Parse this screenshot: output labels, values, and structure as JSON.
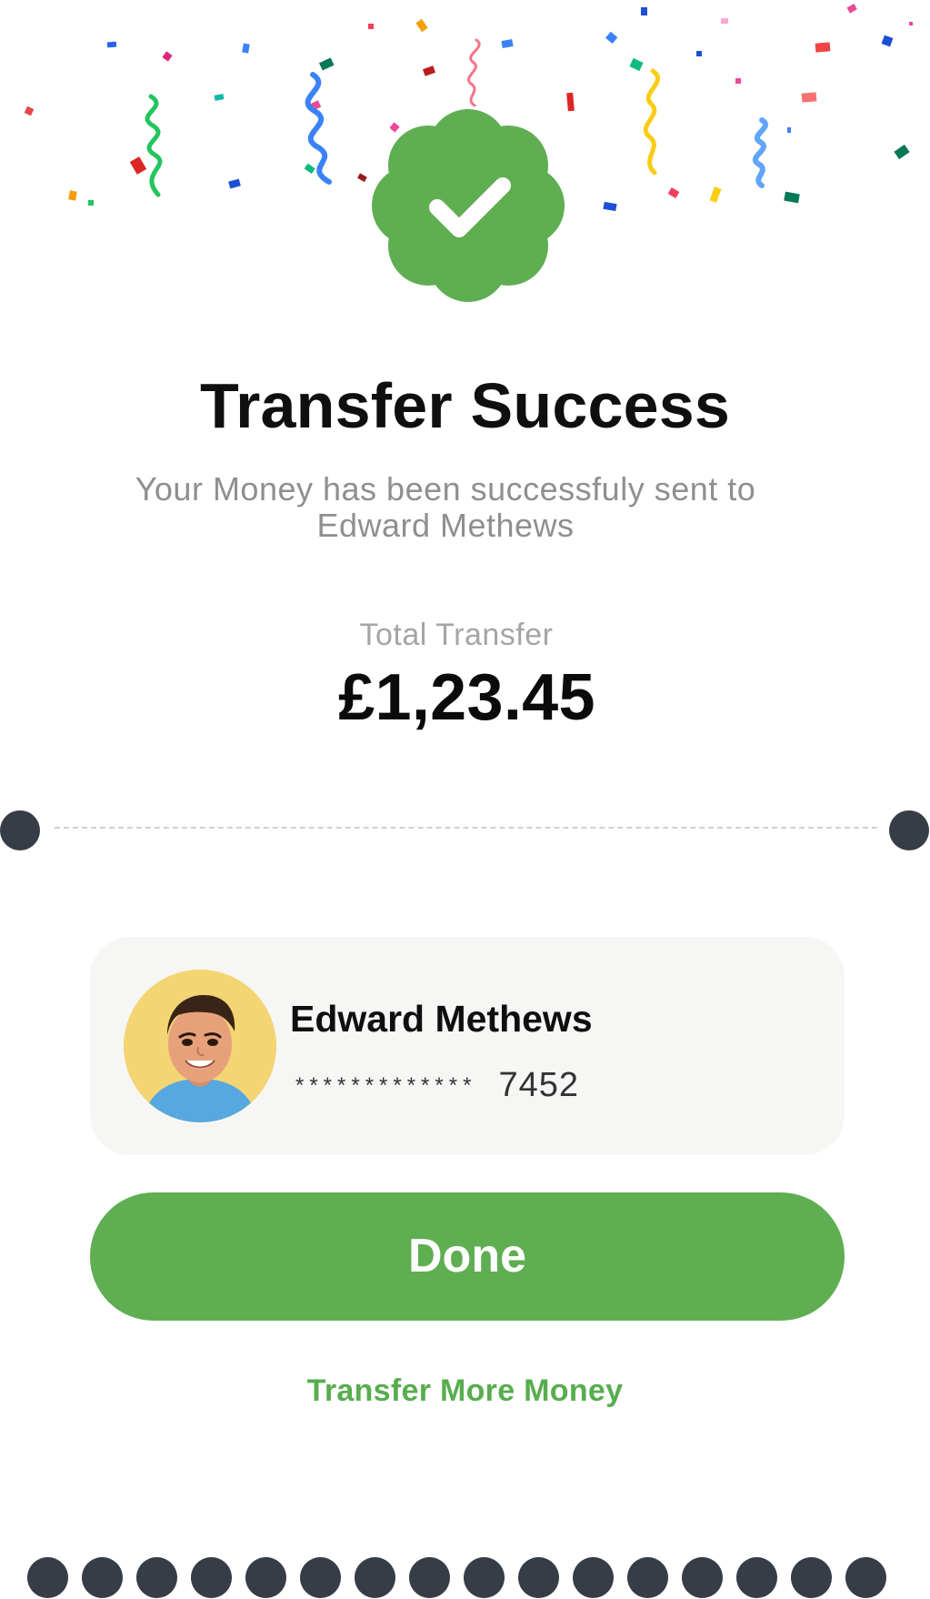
{
  "header": {
    "title": "Transfer Success",
    "subtitle": "Your Money has been successfuly sent to Edward Methews"
  },
  "summary": {
    "total_label": "Total Transfer",
    "amount": "£1,23.45"
  },
  "recipient": {
    "name": "Edward Methews",
    "masked_digits": "*************",
    "last4": "7452"
  },
  "actions": {
    "done_label": "Done",
    "transfer_more_label": "Transfer More Money"
  },
  "colors": {
    "accent": "#5fae52",
    "title_text": "#0f0f0f",
    "secondary_text": "#8f8f8f",
    "card_bg": "#f6f7f5",
    "notch": "#363d47",
    "avatar_bg": "#f4d574"
  },
  "icons": {
    "success": "check-badge-icon",
    "confetti": "confetti-decoration"
  }
}
